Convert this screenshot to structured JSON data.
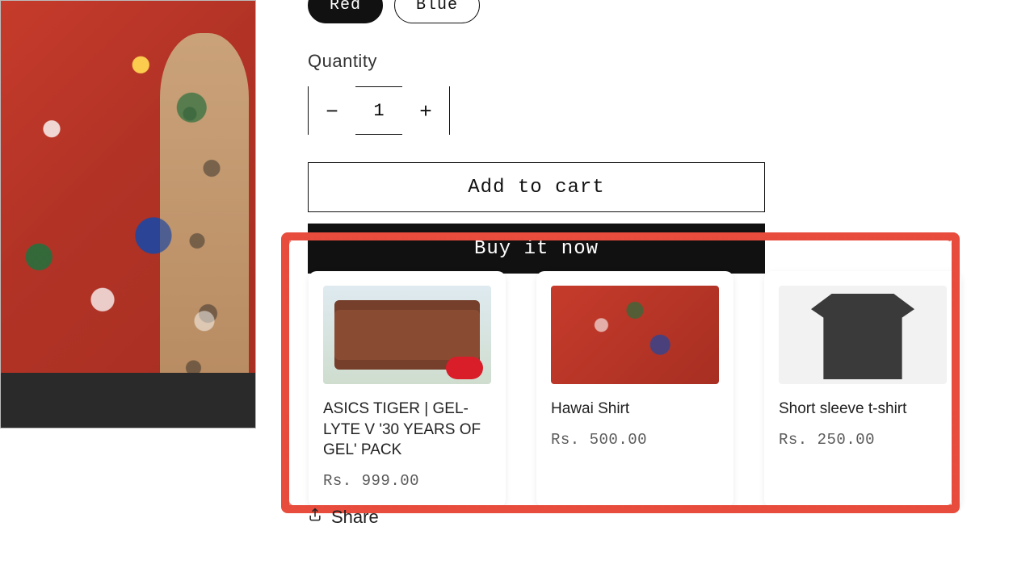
{
  "variants": {
    "options": [
      {
        "label": "Red",
        "selected": true
      },
      {
        "label": "Blue",
        "selected": false
      }
    ]
  },
  "quantity": {
    "label": "Quantity",
    "value": "1"
  },
  "cta": {
    "add_to_cart": "Add to cart",
    "buy_now": "Buy it now"
  },
  "share": {
    "label": "Share"
  },
  "recommendations": [
    {
      "title": "ASICS TIGER | GEL-LYTE V '30 YEARS OF GEL' PACK",
      "price": "Rs. 999.00",
      "thumb": "kitkat"
    },
    {
      "title": "Hawai Shirt",
      "price": "Rs. 500.00",
      "thumb": "hawai"
    },
    {
      "title": "Short sleeve t-shirt",
      "price": "Rs. 250.00",
      "thumb": "tee"
    }
  ]
}
